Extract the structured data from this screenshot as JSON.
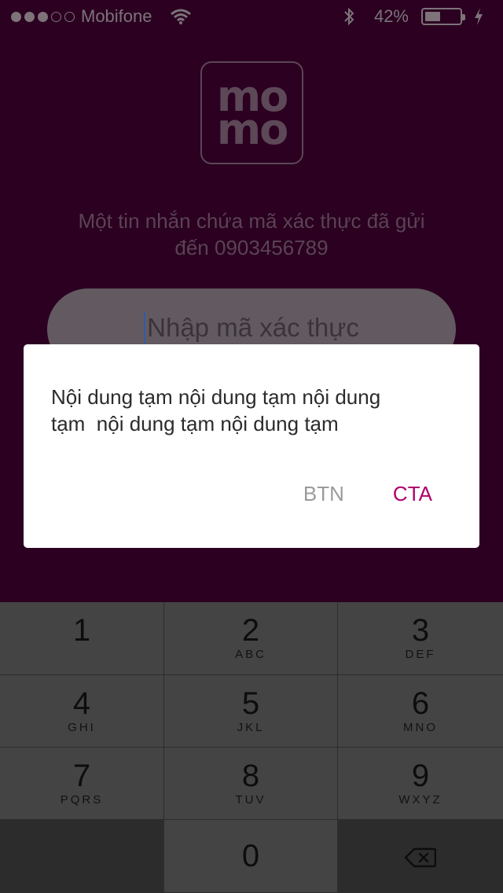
{
  "status_bar": {
    "carrier": "Mobifone",
    "battery_percent": "42%",
    "battery_level": 0.42,
    "signal_bars": 3,
    "signal_total": 5
  },
  "logo": {
    "line1": "mo",
    "line2": "mo"
  },
  "verification": {
    "message_line1": "Một tin nhắn chứa mã xác thực đã gửi",
    "message_line2": "đến 0903456789",
    "input_placeholder": "Nhập mã xác thực"
  },
  "dialog": {
    "body": "Nội dung tạm nội dung tạm nội dung\ntạm  nội dung tạm nội dung tạm",
    "secondary_label": "BTN",
    "primary_label": "CTA",
    "primary_color": "#b0006e"
  },
  "keypad": {
    "keys": [
      {
        "digit": "1",
        "letters": ""
      },
      {
        "digit": "2",
        "letters": "ABC"
      },
      {
        "digit": "3",
        "letters": "DEF"
      },
      {
        "digit": "4",
        "letters": "GHI"
      },
      {
        "digit": "5",
        "letters": "JKL"
      },
      {
        "digit": "6",
        "letters": "MNO"
      },
      {
        "digit": "7",
        "letters": "PQRS"
      },
      {
        "digit": "8",
        "letters": "TUV"
      },
      {
        "digit": "9",
        "letters": "WXYZ"
      },
      {
        "digit": "0",
        "letters": ""
      }
    ],
    "delete_icon": "backspace-icon"
  }
}
